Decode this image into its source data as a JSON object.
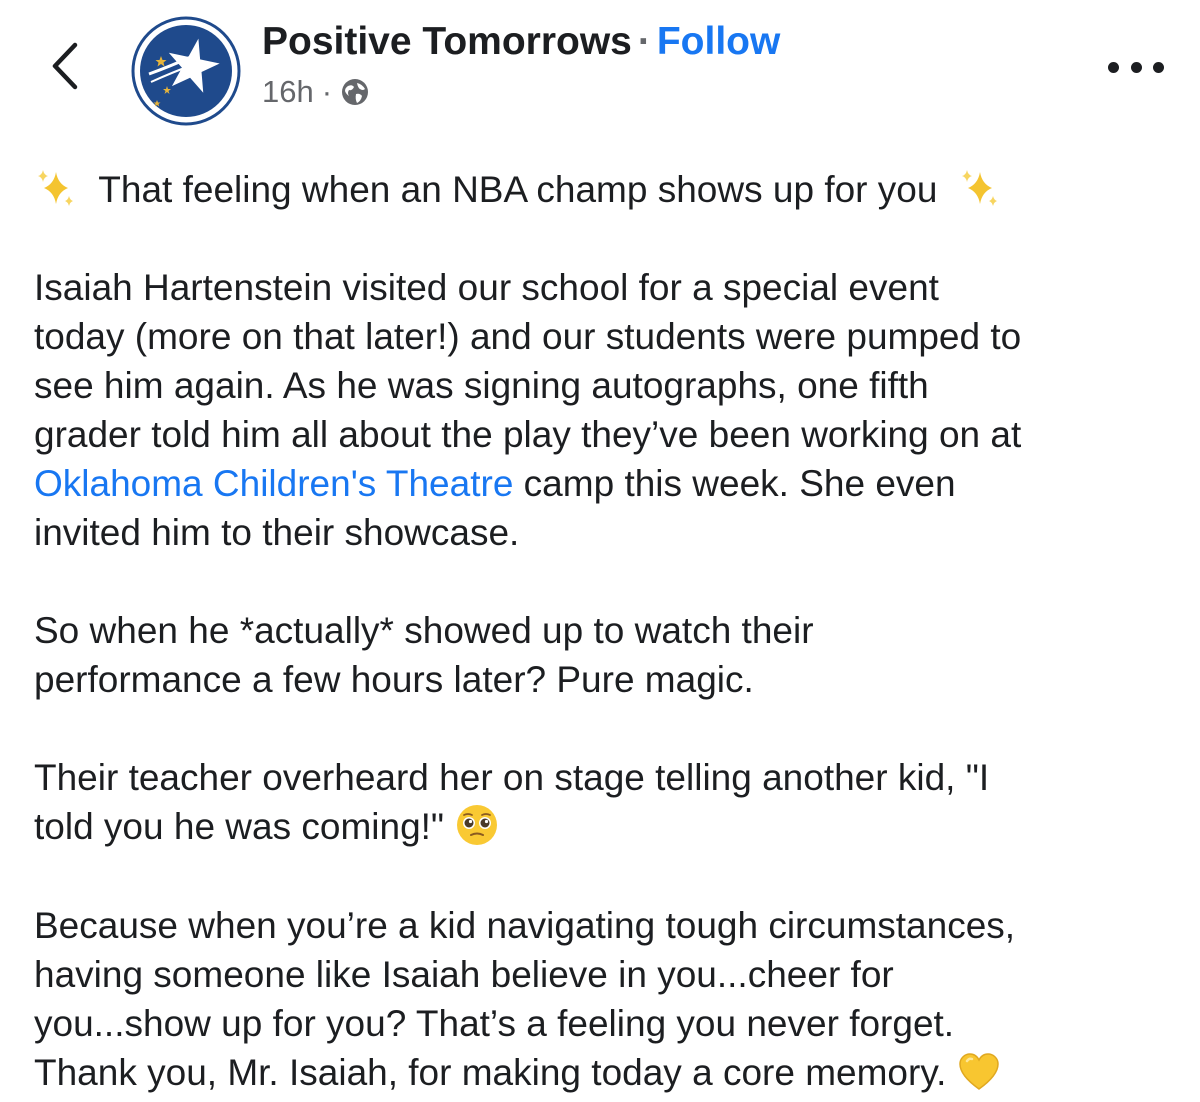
{
  "header": {
    "page_name": "Positive Tomorrows",
    "separator": "·",
    "follow_label": "Follow",
    "timestamp": "16h",
    "meta_separator": "·",
    "audience_icon": "globe-icon",
    "back_icon": "chevron-left-icon",
    "more_icon": "more-horizontal-icon",
    "avatar_icon": "star-logo"
  },
  "post": {
    "headline": "That feeling when an NBA champ shows up for you",
    "p1_l1": "Isaiah Hartenstein visited our school for a special event",
    "p1_l2": "today (more on that later!) and our students were pumped to",
    "p1_l3": "see him again. As he was signing autographs, one fifth",
    "p1_l4": "grader told him all about the play they’ve been working on at",
    "p1_link": "Oklahoma Children's Theatre",
    "p1_l5_rest": " camp this week. She even",
    "p1_l6": "invited him to their showcase.",
    "p2_l1": "So when he *actually* showed up to watch their",
    "p2_l2": "performance a few hours later? Pure magic.",
    "p3_l1": "Their teacher overheard her on stage telling another kid, \"I",
    "p3_l2": "told you he was coming!\" ",
    "p4_l1": "Because when you’re a kid navigating tough circumstances,",
    "p4_l2": "having someone like Isaiah believe in you...cheer for",
    "p4_l3": "you...show up for you? That’s a feeling you never forget.",
    "p4_l4": "Thank you, Mr. Isaiah, for making today a core memory. "
  },
  "colors": {
    "text": "#1c1e21",
    "secondary": "#65676b",
    "link": "#1877f2",
    "avatar_blue": "#1f4a8c"
  }
}
